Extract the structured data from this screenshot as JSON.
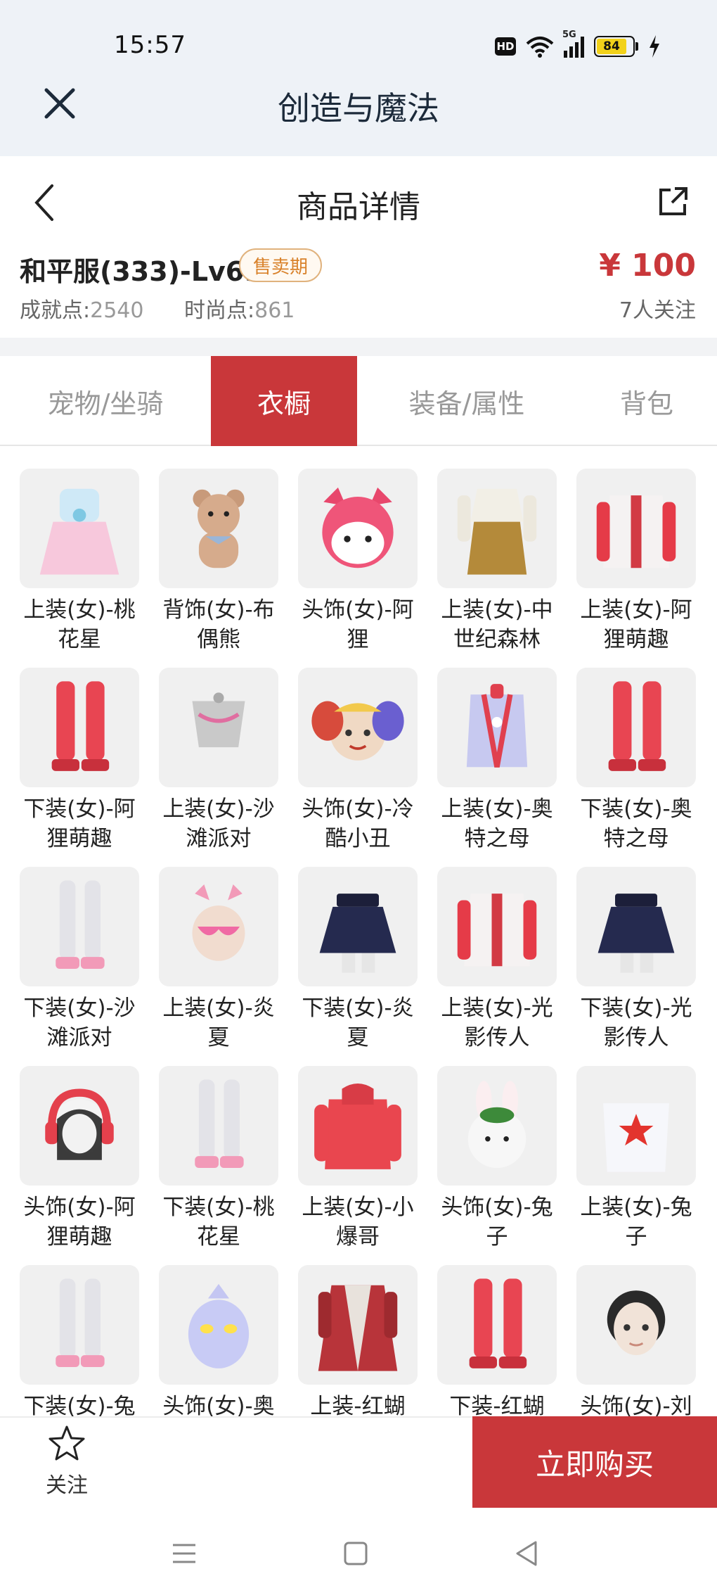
{
  "status_bar": {
    "time": "15:57",
    "hd": "HD",
    "network": "5G",
    "battery": "84"
  },
  "app_bar": {
    "title": "创造与魔法"
  },
  "detail_header": {
    "title": "商品详情"
  },
  "product": {
    "name": "和平服(333)-Lv69",
    "badge": "售卖期",
    "achievement_label": "成就点:",
    "achievement_value": "2540",
    "fashion_label": "时尚点:",
    "fashion_value": "861",
    "price": "¥ 100",
    "followers": "7人关注"
  },
  "tabs": [
    {
      "label": "宠物/坐骑",
      "active": false
    },
    {
      "label": "衣橱",
      "active": true
    },
    {
      "label": "装备/属性",
      "active": false
    },
    {
      "label": "背包",
      "active": false
    }
  ],
  "items": [
    {
      "label": "上装(女)-桃花星",
      "icon": "dress-icon"
    },
    {
      "label": "背饰(女)-布偶熊",
      "icon": "teddy-bear-icon"
    },
    {
      "label": "头饰(女)-阿狸",
      "icon": "fox-head-icon"
    },
    {
      "label": "上装(女)-中世纪森林",
      "icon": "tunic-icon"
    },
    {
      "label": "上装(女)-阿狸萌趣",
      "icon": "jacket-icon"
    },
    {
      "label": "下装(女)-阿狸萌趣",
      "icon": "boots-icon"
    },
    {
      "label": "上装(女)-沙滩派对",
      "icon": "top-icon"
    },
    {
      "label": "头饰(女)-冷酷小丑",
      "icon": "clown-head-icon"
    },
    {
      "label": "上装(女)-奥特之母",
      "icon": "suit-top-icon"
    },
    {
      "label": "下装(女)-奥特之母",
      "icon": "boots-icon"
    },
    {
      "label": "下装(女)-沙滩派对",
      "icon": "legs-icon"
    },
    {
      "label": "上装(女)-炎夏",
      "icon": "bikini-top-icon"
    },
    {
      "label": "下装(女)-炎夏",
      "icon": "skirt-icon"
    },
    {
      "label": "上装(女)-光影传人",
      "icon": "jacket-icon"
    },
    {
      "label": "下装(女)-光影传人",
      "icon": "skirt-icon"
    },
    {
      "label": "头饰(女)-阿狸萌趣",
      "icon": "headphones-head-icon"
    },
    {
      "label": "下装(女)-桃花星",
      "icon": "legs-icon"
    },
    {
      "label": "上装(女)-小爆哥",
      "icon": "hoodie-icon"
    },
    {
      "label": "头饰(女)-兔子",
      "icon": "rabbit-head-icon"
    },
    {
      "label": "上装(女)-兔子",
      "icon": "onesie-icon"
    },
    {
      "label": "下装(女)-兔",
      "icon": "legs-icon"
    },
    {
      "label": "头饰(女)-奥",
      "icon": "mask-head-icon"
    },
    {
      "label": "上装-红蝴",
      "icon": "robe-icon"
    },
    {
      "label": "下装-红蝴",
      "icon": "boots-icon"
    },
    {
      "label": "头饰(女)-刘",
      "icon": "girl-head-icon"
    }
  ],
  "bottom_bar": {
    "follow_label": "关注",
    "buy_label": "立即购买"
  },
  "colors": {
    "accent": "#c9373a",
    "badge": "#d9822b",
    "topbar": "#eef2f7"
  }
}
